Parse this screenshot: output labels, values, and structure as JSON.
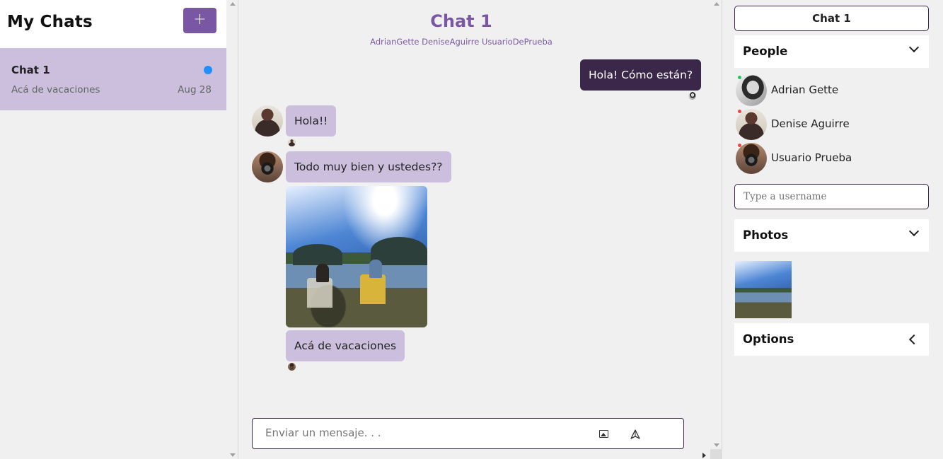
{
  "sidebar": {
    "title": "My Chats",
    "new_chat_label": "+",
    "chats": [
      {
        "title": "Chat 1",
        "preview": "Acá de vacaciones",
        "date": "Aug 28",
        "unread": true
      }
    ]
  },
  "chat": {
    "title": "Chat 1",
    "members": "AdrianGette DeniseAguirre UsuarioDePrueba",
    "messages": [
      {
        "sender": "me",
        "text": "Hola! Cómo están?"
      },
      {
        "sender": "DeniseAguirre",
        "text": "Hola!!"
      },
      {
        "sender": "UsuarioDePrueba",
        "text": "Todo muy bien y ustedes??"
      },
      {
        "sender": "UsuarioDePrueba",
        "type": "image",
        "text": ""
      },
      {
        "sender": "UsuarioDePrueba",
        "text": "Acá de vacaciones"
      }
    ],
    "input_placeholder": "Enviar un mensaje. . .",
    "input_value": ""
  },
  "settings": {
    "chat_name": "Chat 1",
    "people_label": "People",
    "people": [
      {
        "name": "Adrian Gette",
        "status": "online",
        "status_color": "#22c55e"
      },
      {
        "name": "Denise Aguirre",
        "status": "offline",
        "status_color": "#ef4444"
      },
      {
        "name": "Usuario Prueba",
        "status": "offline",
        "status_color": "#ef4444"
      }
    ],
    "username_placeholder": "Type a username",
    "photos_label": "Photos",
    "options_label": "Options"
  },
  "icons": {
    "add": "plus-icon",
    "image": "image-icon",
    "send": "send-icon",
    "expand": "chevron-down-icon",
    "collapse": "chevron-left-icon"
  },
  "colors": {
    "accent": "#7a57a5",
    "selected_chat": "#cbbfdd",
    "my_bubble": "#3b2749",
    "their_bubble": "#cbbfdd",
    "unread_dot": "#1e90ff"
  }
}
